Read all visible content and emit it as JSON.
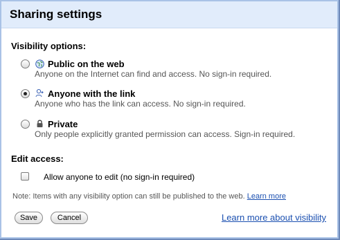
{
  "dialog": {
    "title": "Sharing settings"
  },
  "visibility": {
    "heading": "Visibility options:",
    "options": [
      {
        "title": "Public on the web",
        "description": "Anyone on the Internet can find and access. No sign-in required.",
        "icon": "globe-icon",
        "selected": false
      },
      {
        "title": "Anyone with the link",
        "description": "Anyone who has the link can access. No sign-in required.",
        "icon": "people-link-icon",
        "selected": true
      },
      {
        "title": "Private",
        "description": "Only people explicitly granted permission can access. Sign-in required.",
        "icon": "lock-icon",
        "selected": false
      }
    ]
  },
  "edit_access": {
    "heading": "Edit access:",
    "checkbox_label": "Allow anyone to edit (no sign-in required)",
    "checked": false
  },
  "note": {
    "text": "Note: Items with any visibility option can still be published to the web.",
    "link_label": "Learn more"
  },
  "buttons": {
    "save_label": "Save",
    "cancel_label": "Cancel"
  },
  "footer_link": "Learn more about visibility"
}
